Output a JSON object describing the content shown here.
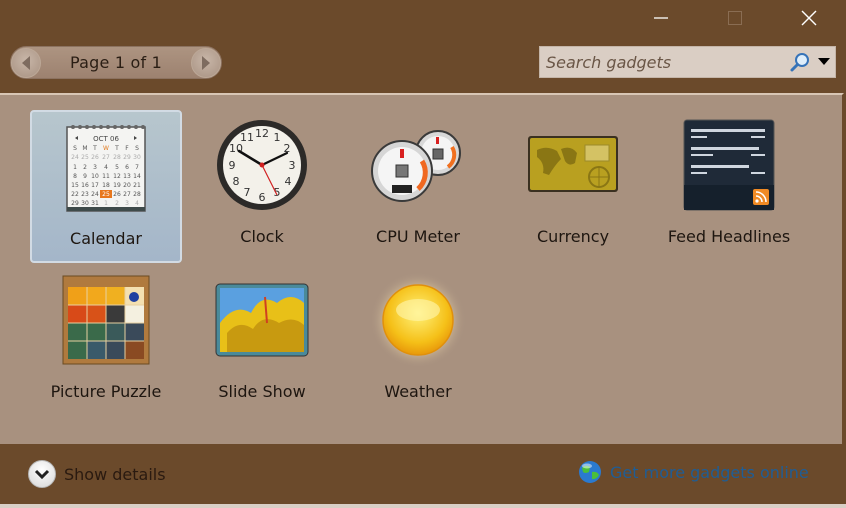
{
  "window": {
    "controls": [
      {
        "name": "minimize-button",
        "icon": "minimize-icon"
      },
      {
        "name": "maximize-button",
        "icon": "maximize-icon"
      },
      {
        "name": "close-button",
        "icon": "close-icon"
      }
    ]
  },
  "pager": {
    "label": "Page 1 of 1",
    "prev_icon": "arrow-left-icon",
    "next_icon": "arrow-right-icon"
  },
  "search": {
    "placeholder": "Search gadgets",
    "value": "",
    "icon": "search-icon",
    "dropdown_icon": "dropdown-arrow-icon"
  },
  "gadgets": [
    {
      "name": "Calendar",
      "icon": "calendar-icon",
      "selected": true
    },
    {
      "name": "Clock",
      "icon": "clock-icon",
      "selected": false
    },
    {
      "name": "CPU Meter",
      "icon": "cpu-meter-icon",
      "selected": false
    },
    {
      "name": "Currency",
      "icon": "currency-icon",
      "selected": false
    },
    {
      "name": "Feed Headlines",
      "icon": "feed-headlines-icon",
      "selected": false
    },
    {
      "name": "Picture Puzzle",
      "icon": "picture-puzzle-icon",
      "selected": false
    },
    {
      "name": "Slide Show",
      "icon": "slide-show-icon",
      "selected": false
    },
    {
      "name": "Weather",
      "icon": "weather-icon",
      "selected": false
    }
  ],
  "calendar_thumb": {
    "month": "OCT 06",
    "weekdays": [
      "S",
      "M",
      "T",
      "W",
      "T",
      "F",
      "S"
    ],
    "highlight_day": "25"
  },
  "footer": {
    "show_details_label": "Show details",
    "get_more_label": "Get more gadgets online",
    "colors": {
      "link": "#1f5d95"
    }
  },
  "colors": {
    "frame": "#6b4a2b",
    "panel": "#a8917f",
    "selected_tile": "#a4b6c9"
  }
}
